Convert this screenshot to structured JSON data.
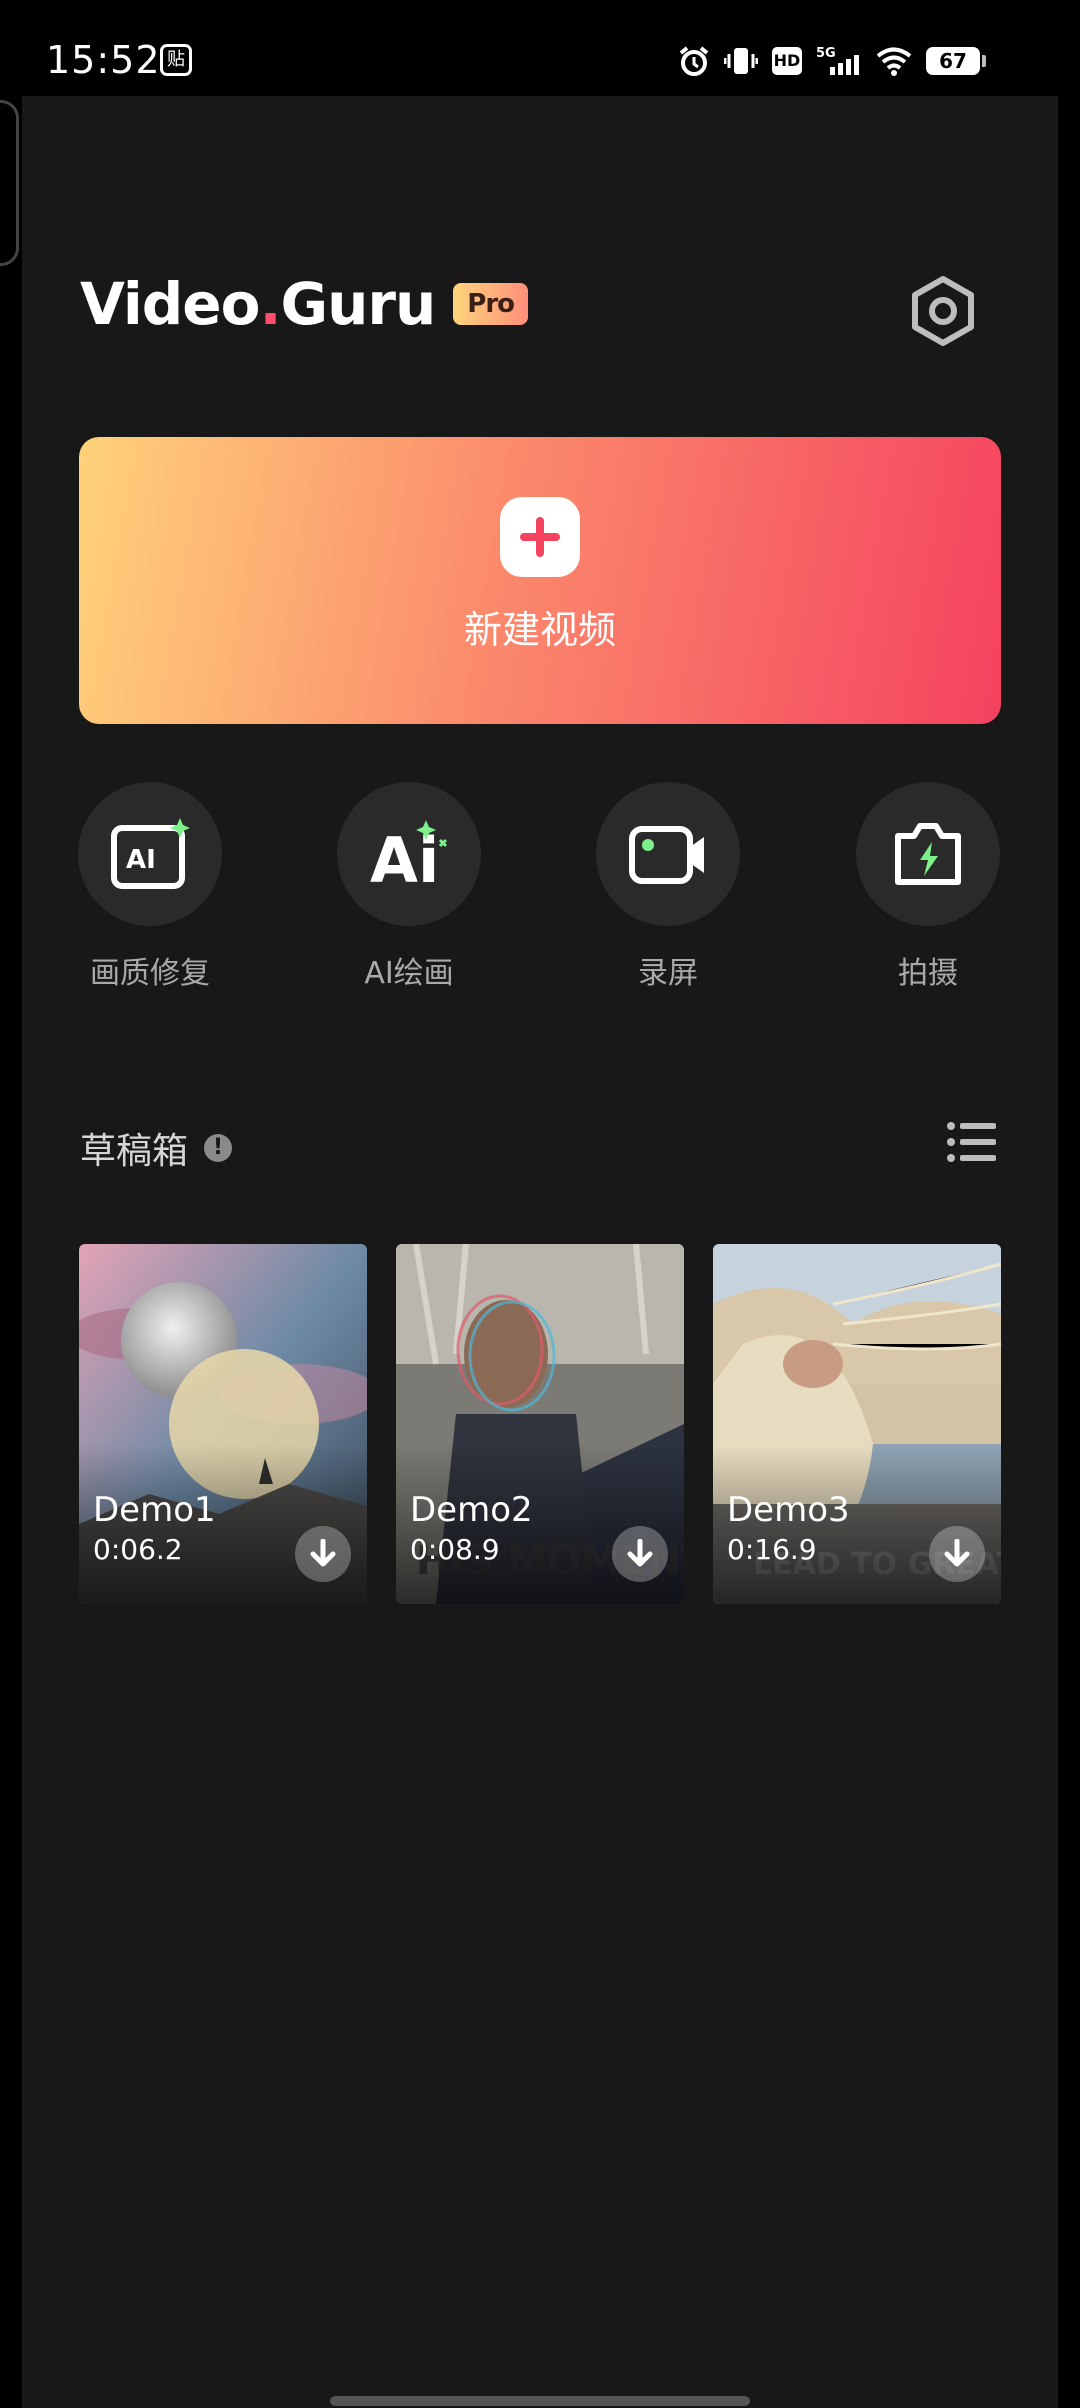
{
  "status_bar": {
    "time": "15:52",
    "notification_glyph": "贴",
    "network": "5G",
    "hd": "HD",
    "battery": "67"
  },
  "header": {
    "logo_part1": "Video",
    "logo_part2": "Guru",
    "pro_badge": "Pro",
    "settings_icon": "hexagon-gear-icon"
  },
  "new_video": {
    "label": "新建视频",
    "icon": "plus-icon"
  },
  "tools": [
    {
      "label": "画质修复",
      "icon": "ai-enhance-icon"
    },
    {
      "label": "AI绘画",
      "icon": "ai-paint-icon"
    },
    {
      "label": "录屏",
      "icon": "screen-record-icon"
    },
    {
      "label": "拍摄",
      "icon": "camera-icon"
    }
  ],
  "drafts": {
    "title": "草稿箱",
    "info_icon": "!",
    "list_icon": "list-view-icon",
    "items": [
      {
        "name": "Demo1",
        "duration": "0:06.2"
      },
      {
        "name": "Demo2",
        "duration": "0:08.9"
      },
      {
        "name": "Demo3",
        "duration": "0:16.9"
      }
    ]
  },
  "colors": {
    "background": "#181818",
    "banner_start": "#ffd27a",
    "banner_end": "#f5425f",
    "accent_green": "#7ef08a"
  }
}
